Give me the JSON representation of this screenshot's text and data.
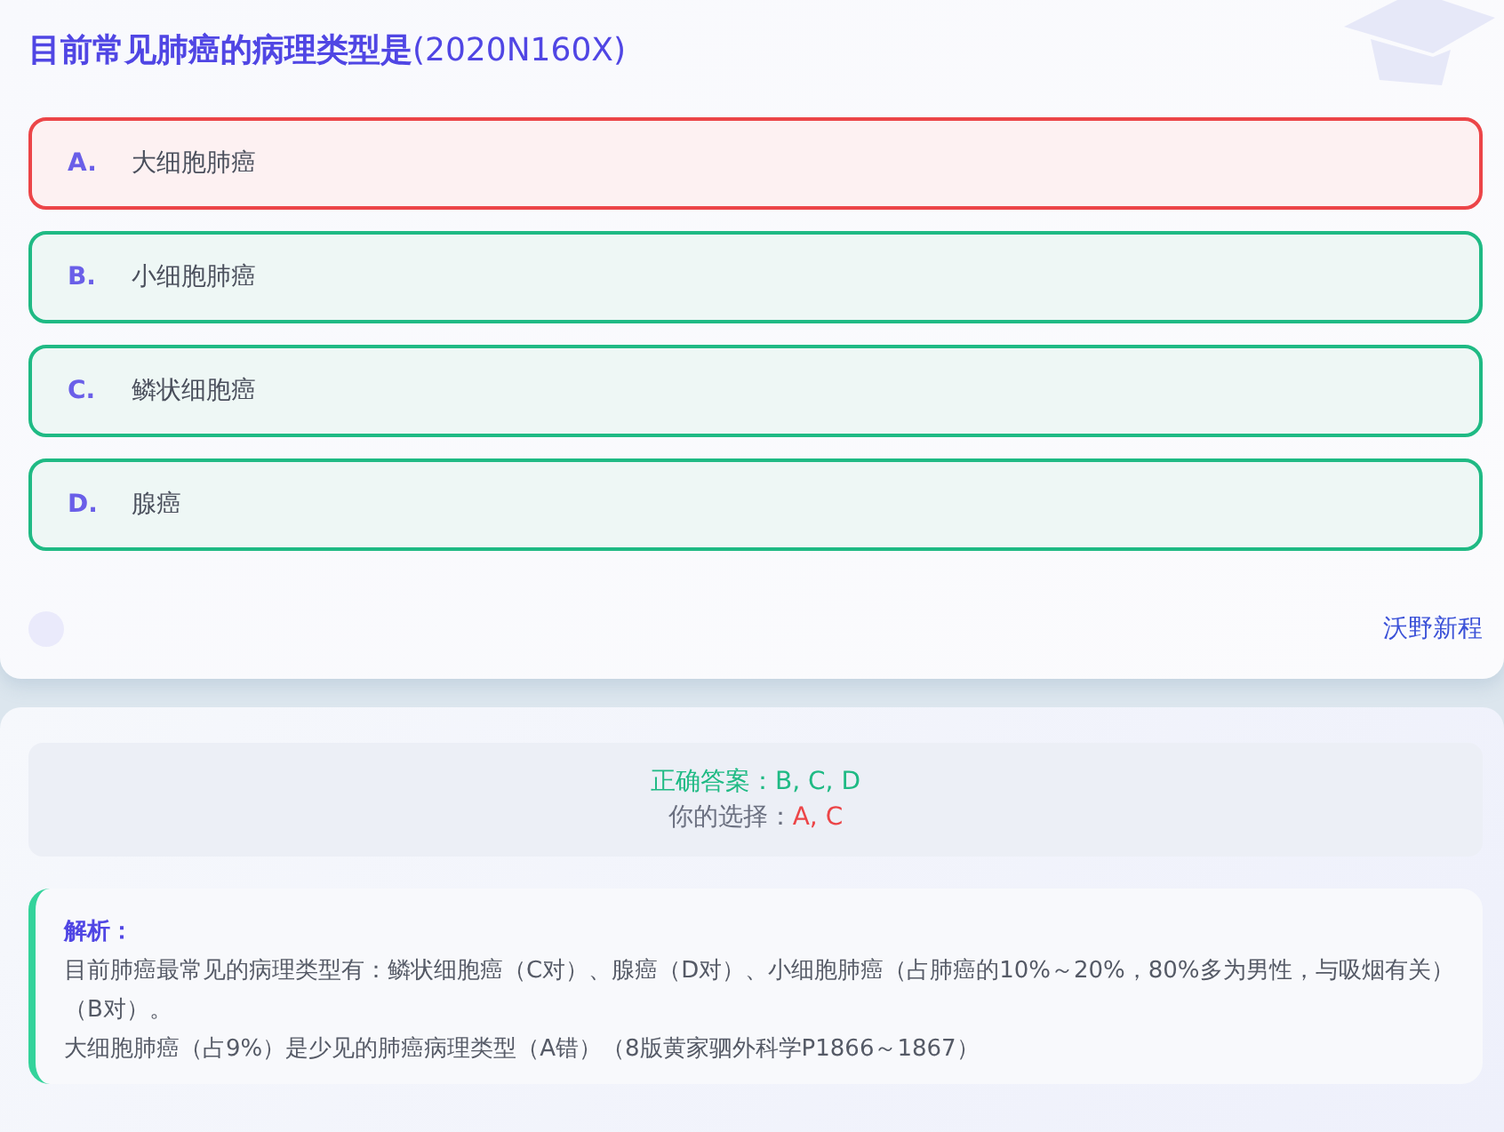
{
  "question": {
    "title": "目前常见肺癌的病理类型是",
    "code": "(2020N160X)"
  },
  "options": [
    {
      "letter": "A.",
      "text": "大细胞肺癌",
      "kind": "wrong"
    },
    {
      "letter": "B.",
      "text": "小细胞肺癌",
      "kind": "correct"
    },
    {
      "letter": "C.",
      "text": "鳞状细胞癌",
      "kind": "correct"
    },
    {
      "letter": "D.",
      "text": "腺癌",
      "kind": "correct"
    }
  ],
  "source": "沃野新程",
  "result": {
    "correct_label": "正确答案：",
    "correct_value": "B, C, D",
    "choice_label": "你的选择：",
    "choice_value": "A, C"
  },
  "analysis": {
    "title": "解析：",
    "paragraphs": [
      "目前肺癌最常见的病理类型有：鳞状细胞癌（C对）、腺癌（D对）、小细胞肺癌（占肺癌的10%～20%，80%多为男性，与吸烟有关）（B对）。",
      "大细胞肺癌（占9%）是少见的肺癌病理类型（A错）（8版黄家驷外科学P1866～1867）"
    ]
  }
}
